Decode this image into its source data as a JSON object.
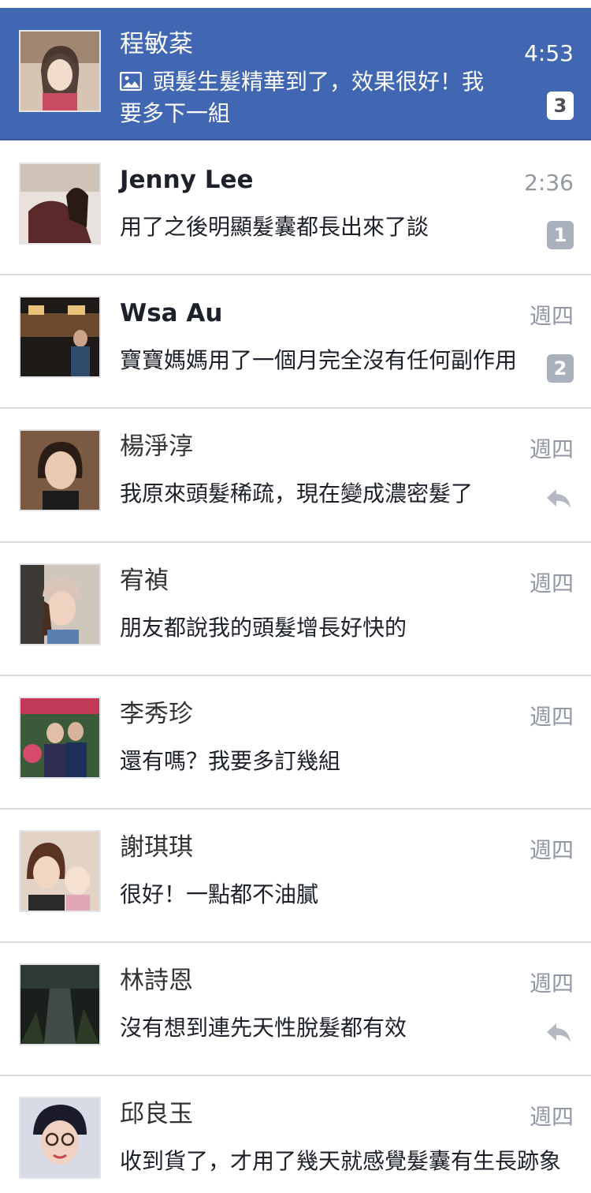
{
  "conversations": [
    {
      "name": "程敏棻",
      "message": "頭髮生髮精華到了，效果很好！我要多下一組",
      "time": "4:53",
      "badge": "3",
      "active": true,
      "has_photo_icon": true,
      "message_icon": "photo-icon"
    },
    {
      "name": "Jenny Lee",
      "message": "用了之後明顯髮囊都長出來了談",
      "time": "2:36",
      "badge": "1"
    },
    {
      "name": "Wsa Au",
      "message": "寶寶媽媽用了一個月完全沒有任何副作用",
      "time": "週四",
      "badge": "2"
    },
    {
      "name": "楊淨淳",
      "message": "我原來頭髮稀疏，現在變成濃密髮了",
      "time": "週四",
      "status_icon": "reply-icon"
    },
    {
      "name": "宥禎",
      "message": "朋友都說我的頭髮增長好快的",
      "time": "週四"
    },
    {
      "name": "李秀珍",
      "message": "還有嗎？我要多訂幾組",
      "time": "週四"
    },
    {
      "name": "謝琪琪",
      "message": "很好！一點都不油膩",
      "time": "週四"
    },
    {
      "name": "林詩恩",
      "message": "沒有想到連先天性脫髮都有效",
      "time": "週四",
      "status_icon": "reply-icon"
    },
    {
      "name": "邱良玉",
      "message": "收到貨了，才用了幾天就感覺髮囊有生長跡象",
      "time": "週四"
    }
  ],
  "colors": {
    "active_background": "#4267b2",
    "badge": "#aab1bd",
    "divider": "#d8dbe2"
  }
}
